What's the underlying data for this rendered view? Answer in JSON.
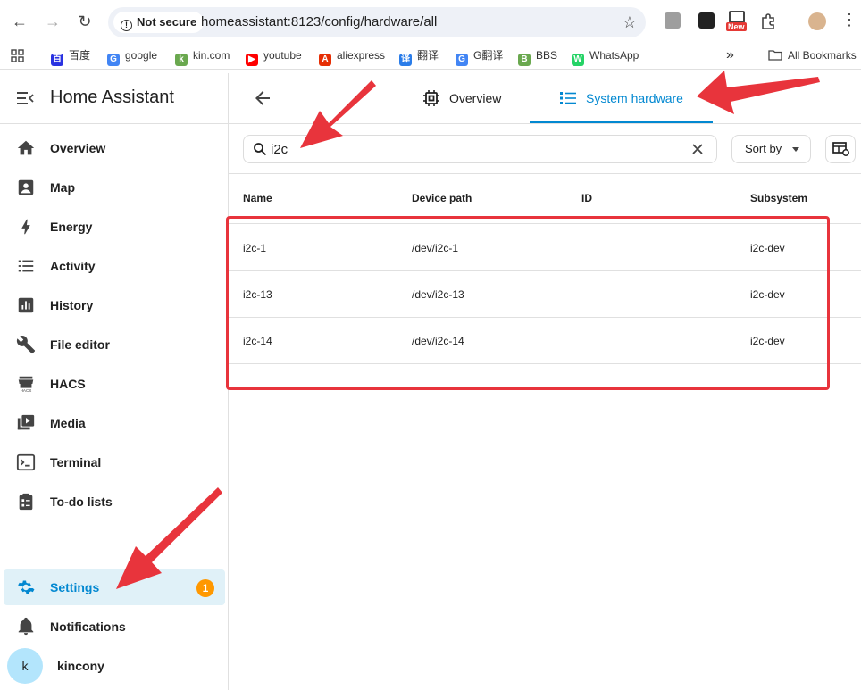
{
  "browser": {
    "security_label": "Not secure",
    "url": "homeassistant:8123/config/hardware/all",
    "bookmarks": [
      {
        "label": "百度",
        "color": "#2932e1",
        "glyph": "百"
      },
      {
        "label": "google",
        "color": "#4285f4",
        "glyph": "G"
      },
      {
        "label": "kin.com",
        "color": "#6aa84f",
        "glyph": "k"
      },
      {
        "label": "youtube",
        "color": "#ff0000",
        "glyph": "▶"
      },
      {
        "label": "aliexpress",
        "color": "#e62e04",
        "glyph": "A"
      },
      {
        "label": "翻译",
        "color": "#2b7de9",
        "glyph": "译"
      },
      {
        "label": "G翻译",
        "color": "#4285f4",
        "glyph": "G"
      },
      {
        "label": "BBS",
        "color": "#6aa84f",
        "glyph": "B"
      },
      {
        "label": "WhatsApp",
        "color": "#25d366",
        "glyph": "W"
      }
    ],
    "all_bookmarks": "All Bookmarks",
    "new_badge": "New"
  },
  "sidebar": {
    "title": "Home Assistant",
    "items": [
      {
        "label": "Overview",
        "icon": "home-icon"
      },
      {
        "label": "Map",
        "icon": "map-icon"
      },
      {
        "label": "Energy",
        "icon": "lightning-icon"
      },
      {
        "label": "Activity",
        "icon": "list-icon"
      },
      {
        "label": "History",
        "icon": "chart-icon"
      },
      {
        "label": "File editor",
        "icon": "wrench-icon"
      },
      {
        "label": "HACS",
        "icon": "hacs-icon"
      },
      {
        "label": "Media",
        "icon": "media-icon"
      },
      {
        "label": "Terminal",
        "icon": "terminal-icon"
      },
      {
        "label": "To-do lists",
        "icon": "clipboard-icon"
      }
    ],
    "settings": {
      "label": "Settings",
      "badge": "1"
    },
    "notifications": {
      "label": "Notifications"
    },
    "user": {
      "initial": "k",
      "name": "kincony"
    }
  },
  "tabs": {
    "overview": "Overview",
    "system_hardware": "System hardware"
  },
  "toolbar": {
    "search_value": "i2c",
    "sort_label": "Sort by"
  },
  "table": {
    "columns": [
      "Name",
      "Device path",
      "ID",
      "Subsystem"
    ],
    "rows": [
      {
        "name": "i2c-1",
        "path": "/dev/i2c-1",
        "id": "",
        "subsystem": "i2c-dev"
      },
      {
        "name": "i2c-13",
        "path": "/dev/i2c-13",
        "id": "",
        "subsystem": "i2c-dev"
      },
      {
        "name": "i2c-14",
        "path": "/dev/i2c-14",
        "id": "",
        "subsystem": "i2c-dev"
      }
    ]
  },
  "colors": {
    "accent": "#0288d1",
    "badge": "#ff9800",
    "annotation": "#e8343c"
  }
}
